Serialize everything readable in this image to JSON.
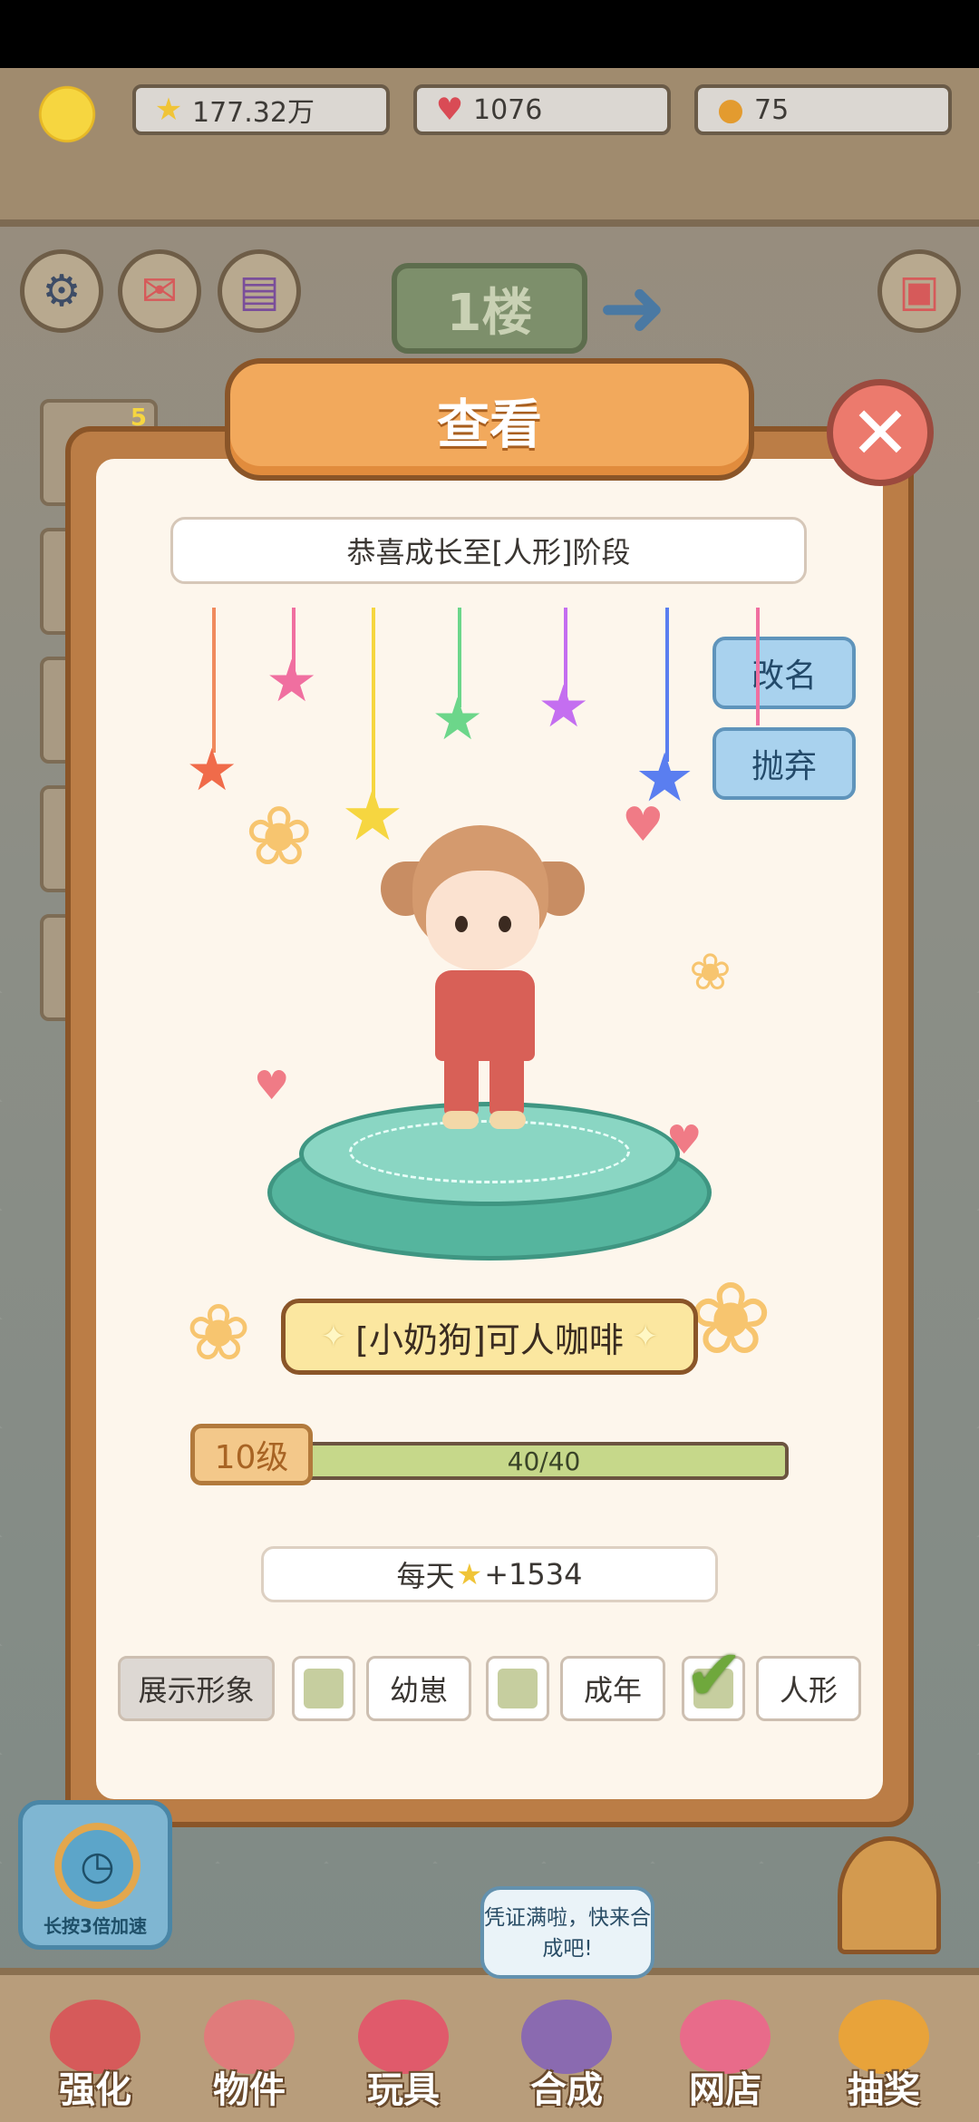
{
  "resources": {
    "stars": "177.32万",
    "hearts": "1076",
    "coins": "75"
  },
  "floor": {
    "label": "1楼"
  },
  "side_slot_badge": "5",
  "dialog": {
    "title": "查看",
    "congrats": "恭喜成长至[人形]阶段",
    "rename_label": "改名",
    "abandon_label": "抛弃",
    "pet_name": "[小奶狗]可人咖啡",
    "level_label": "10级",
    "xp_text": "40/40",
    "xp_progress": 1.0,
    "daily_prefix": "每天",
    "daily_value": "+1534",
    "display_label": "展示形象",
    "stages": [
      {
        "label": "幼崽",
        "checked": false
      },
      {
        "label": "成年",
        "checked": false
      },
      {
        "label": "人形",
        "checked": true
      }
    ]
  },
  "timer_label": "长按3倍加速",
  "bubble_text": "凭证满啦，快来合成吧!",
  "bottom_nav": [
    {
      "label": "强化",
      "color": "#d65a5a"
    },
    {
      "label": "物件",
      "color": "#e07b7b"
    },
    {
      "label": "玩具",
      "color": "#e05a6b"
    },
    {
      "label": "合成",
      "color": "#8a6ab0"
    },
    {
      "label": "网店",
      "color": "#e86b8a"
    },
    {
      "label": "抽奖",
      "color": "#e8a33a"
    }
  ],
  "colors": {
    "dialog_frame": "#bb7d46",
    "title_plate": "#f2a95c",
    "accent_blue": "#a9d2ee",
    "xp_fill": "#c6d88a"
  }
}
